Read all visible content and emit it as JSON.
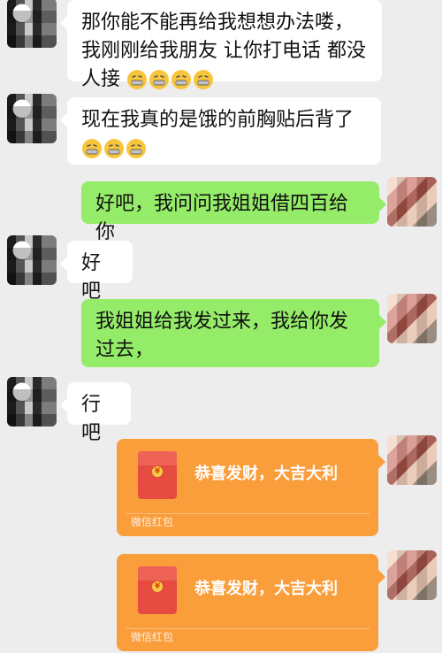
{
  "messages": [
    {
      "side": "left",
      "type": "text",
      "text": "那你能不能再给我想想办法喽，我刚刚给我朋友 让你打电话 都没人接"
    },
    {
      "side": "left",
      "type": "text",
      "text": "现在我真的是饿的前胸贴后背了"
    },
    {
      "side": "right",
      "type": "text",
      "text": "好吧，我问问我姐姐借四百给你"
    },
    {
      "side": "left",
      "type": "text",
      "text": "好吧"
    },
    {
      "side": "right",
      "type": "text",
      "text": "我姐姐给我发过来，我给你发过去，"
    },
    {
      "side": "left",
      "type": "text",
      "text": "行吧"
    }
  ],
  "packets": [
    {
      "title": "恭喜发财，大吉大利",
      "footer": "微信红包"
    },
    {
      "title": "恭喜发财，大吉大利",
      "footer": "微信红包"
    }
  ],
  "icons": {
    "emoji": "grimacing-face-icon",
    "coin": "yuan-coin-icon"
  },
  "colors": {
    "background": "#ededed",
    "incoming": "#ffffff",
    "outgoing": "#95ec69",
    "packet": "#fa9d3b"
  }
}
